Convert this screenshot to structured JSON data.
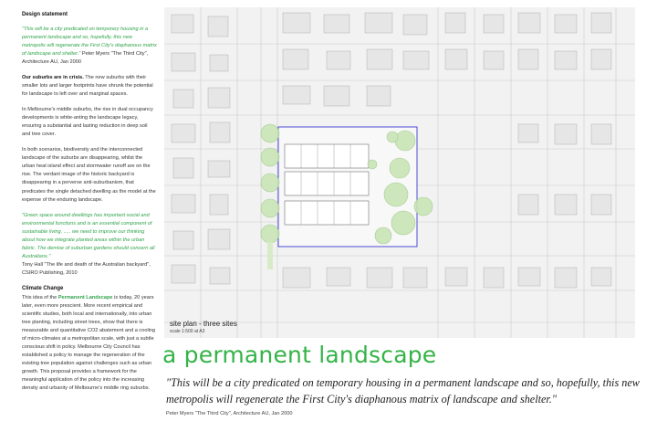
{
  "left": {
    "heading": "Design statement",
    "quote1": "\"This will be a city predicated on temporary housing in a permanent landscape and so, hopefully, this new metropolis will regenerate the First City's diaphanous matrix of landscape and shelter.\"",
    "quote1_cite": "Peter Myers \"The Third City\", Architecture AU, Jan 2000",
    "para1_lead": "Our suburbs are in crisis.",
    "para1": "The new suburbs with their smaller lots and larger footprints have shrunk the potential for landscape to left over and marginal spaces.",
    "para2": "In Melbourne's middle suburbs, the rise in dual occupancy developments is white-anting the landscape legacy, ensuring a substantial and lasting reduction in deep soil and tree cover.",
    "para3": "In both scenarios, biodiversity and the interconnected landscape of the suburbs are disappearing, whilst the urban heat island effect and stormwater runoff are on the rise. The verdant image of the historic backyard is disappearing in a perverse anti-suburbanism, that predicates the single detached dwelling as the model at the expense of the enduring landscape.",
    "quote2": "\"Green space around dwellings has important social and environmental functions and is an essential component of sustainable living. ..... we need to improve our thinking about how we integrate planted areas within the urban fabric. The demise of suburban gardens should concern all Australians.\"",
    "quote2_cite": "Tony Hall \"The life and death of the Australian backyard\", CSIRO Publishing, 2010",
    "climate_heading": "Climate Change",
    "climate_pre": "This idea of the",
    "climate_highlight": "Permanent Landscape",
    "climate_post": "is today, 20 years later, even more prescient. More recent empirical and scientific studies, both local and internationally, into urban tree planting, including street trees, show that there is measurable and quantitative CO2 abatement and a cooling of micro-climates at a metropolitan scale, with just a subtle conscious shift in policy. Melbourne City Council has established a policy to manage the regeneration of the existing tree population against challenges such as urban growth. This proposal provides a framework for the meaningful application of the policy into the increasing density and urbanity of Melbourne's middle ring suburbs."
  },
  "plan": {
    "label": "site plan - three sites",
    "scale": "scale 1:500 at A3"
  },
  "title": "a permanent landscape",
  "main_quote": "\"This will be a city predicated on temporary housing in a permanent landscape and so, hopefully, this new metropolis will regenerate the First City's diaphanous matrix of landscape and shelter.\"",
  "main_cite": "Peter Myers \"The Third City\", Architecture AU, Jan 2000",
  "colors": {
    "accent": "#34b347",
    "plan_bg": "#f2f2f2",
    "site_boundary": "#3a3ad0"
  }
}
